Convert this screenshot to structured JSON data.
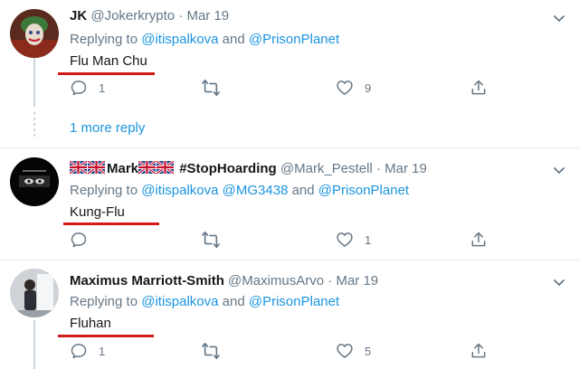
{
  "tweets": [
    {
      "name": "JK",
      "handle": "@Jokerkrypto",
      "separator": "·",
      "date": "Mar 19",
      "replying_prefix": "Replying to",
      "mention1": "@itispalkova",
      "and_text": "and",
      "mention2": "@PrisonPlanet",
      "text": "Flu Man Chu",
      "reply_count": "1",
      "retweet_count": "",
      "like_count": "9"
    },
    {
      "name_prefix_flags": "🇬🇧🇬🇧",
      "name": "Mark",
      "name_suffix": "#StopHoarding",
      "handle": "@Mark_Pestell",
      "separator": "·",
      "date": "Mar 19",
      "replying_prefix": "Replying to",
      "mention1": "@itispalkova",
      "mention2": "@MG3438",
      "and_text": "and",
      "mention3": "@PrisonPlanet",
      "text": "Kung-Flu",
      "reply_count": "",
      "retweet_count": "",
      "like_count": "1"
    },
    {
      "name": "Maximus Marriott-Smith",
      "handle": "@MaximusArvo",
      "separator": "·",
      "date": "Mar 19",
      "replying_prefix": "Replying to",
      "mention1": "@itispalkova",
      "and_text": "and",
      "mention2": "@PrisonPlanet",
      "text": "Fluhan",
      "reply_count": "1",
      "retweet_count": "",
      "like_count": "5"
    }
  ],
  "more_reply": "1 more reply",
  "colors": {
    "link": "#1b95e0",
    "secondary": "#657786",
    "divider": "#e6ecf0",
    "underline": "#d11b1b"
  },
  "icons": [
    "reply-icon",
    "retweet-icon",
    "like-icon",
    "share-icon",
    "chevron-down-icon"
  ]
}
